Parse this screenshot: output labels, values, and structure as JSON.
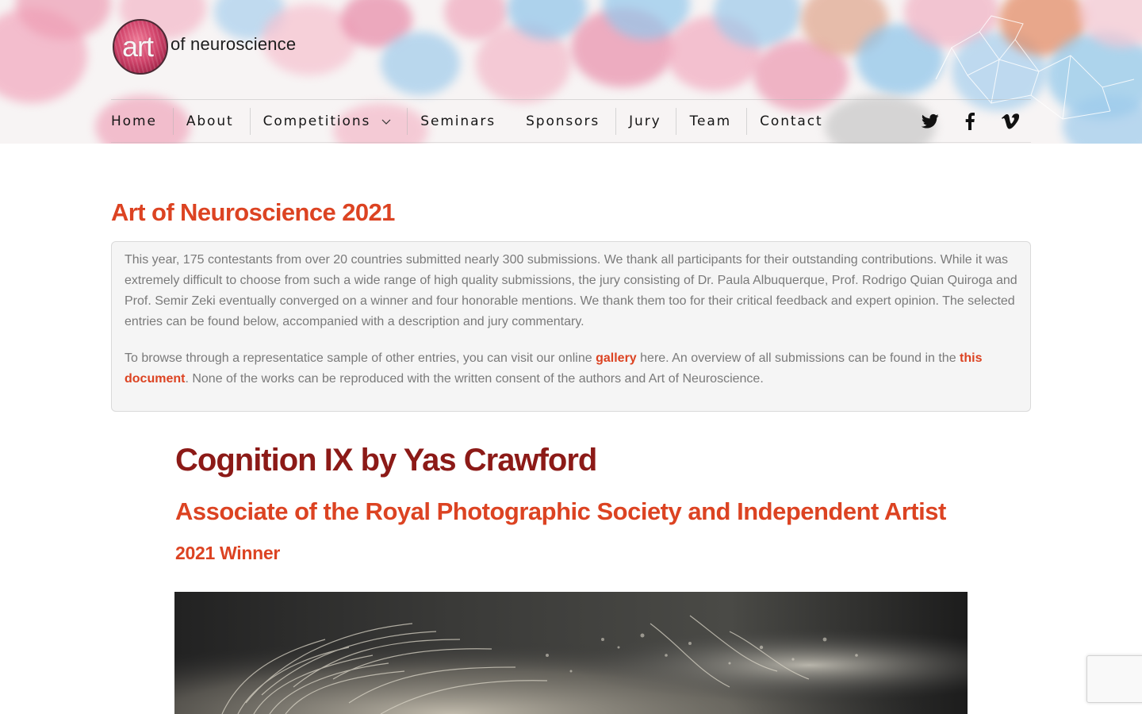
{
  "header": {
    "logo_art": "art",
    "logo_text": "of neuroscience"
  },
  "nav": {
    "items": [
      {
        "label": "Home"
      },
      {
        "label": "About"
      },
      {
        "label": "Competitions"
      },
      {
        "label": "Seminars"
      },
      {
        "label": "Sponsors"
      },
      {
        "label": "Jury"
      },
      {
        "label": "Team"
      },
      {
        "label": "Contact"
      }
    ],
    "social": [
      "twitter-icon",
      "facebook-icon",
      "vimeo-icon"
    ]
  },
  "main": {
    "page_title": "Art of Neuroscience 2021",
    "intro_p1": "This year, 175 contestants from over 20 countries submitted nearly 300 submissions. We thank all participants for their outstanding contributions. While it was extremely difficult to choose from such a wide range of high quality submissions, the jury consisting of Dr. Paula Albuquerque, Prof. Rodrigo Quian Quiroga and Prof. Semir Zeki eventually converged on a winner and four honorable mentions. We thank them too for their critical feedback and expert opinion. The selected entries can be found below, accompanied with a description and jury commentary.",
    "intro_p2_a": "To browse through a representatice sample of other entries, you can visit our online ",
    "intro_p2_link1": "gallery",
    "intro_p2_b": " here. An overview of all submissions can be found in the ",
    "intro_p2_link2": "this document",
    "intro_p2_c": ". None of the works can be reproduced with the written consent of the authors and Art of Neuroscience.",
    "entry_title": "Cognition IX by Yas Crawford",
    "entry_subtitle": "Associate of the Royal Photographic Society and Independent Artist",
    "entry_award": "2021 Winner"
  },
  "colors": {
    "accent": "#dc4322",
    "entry_title": "#8c1a17",
    "text": "#7a7a7a"
  }
}
